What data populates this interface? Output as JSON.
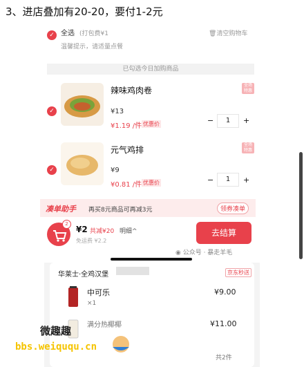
{
  "heading": "3、进店叠加有20-20，要付1-2元",
  "select_all": {
    "label": "全选",
    "sub": "(打包费¥1",
    "clear": "清空购物车"
  },
  "tip": "温馨提示，请适量点餐",
  "banner": "已勾选今日加购商品",
  "products": [
    {
      "name": "辣味鸡肉卷",
      "price": "¥13",
      "promo": "¥1.19 /件",
      "tag": "优惠价",
      "qty": "1"
    },
    {
      "name": "元气鸡排",
      "price": "¥9",
      "promo": "¥0.81 /件",
      "tag": "优惠价",
      "qty": "1"
    }
  ],
  "helper": {
    "brand": "凑单助手",
    "text": "再买8元商品可再减3元",
    "button": "领券凑单"
  },
  "checkout": {
    "badge": "2",
    "total": "¥2",
    "saved": "共减¥20",
    "detail": "明细",
    "delivery": "免运费 ¥2.2",
    "pay": "去结算"
  },
  "watermark": "公众号 · 暴走羊毛",
  "store": {
    "name": "华莱士·全鸡汉堡",
    "tag": "京东秒送"
  },
  "store_items": [
    {
      "name": "中可乐",
      "qty": "×1",
      "price": "¥9.00"
    },
    {
      "name": "满分热椰椰",
      "qty": "",
      "price": "¥11.00"
    }
  ],
  "count": "共2件",
  "site_logo": {
    "top": "微趣趣",
    "bottom": "bbs.weiququ.cn"
  }
}
